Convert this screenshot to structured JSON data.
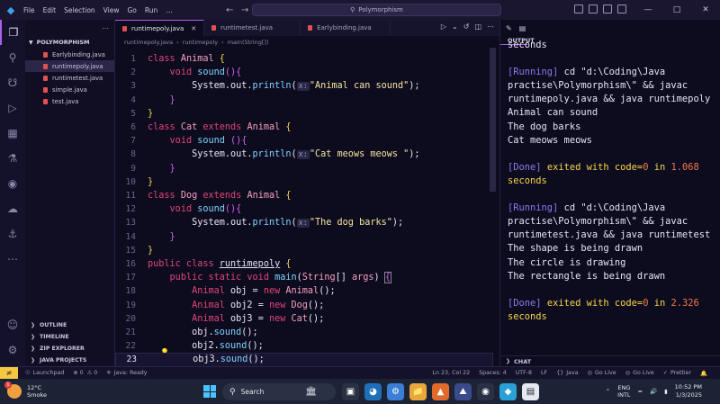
{
  "titlebar": {
    "menu": [
      "File",
      "Edit",
      "Selection",
      "View",
      "Go",
      "Run",
      "…"
    ],
    "search_text": "Polymorphism"
  },
  "sidebar": {
    "folder": "POLYMORPHISM",
    "files": [
      "Earlybinding.java",
      "runtimepoly.java",
      "runtimetest.java",
      "simple.java",
      "test.java"
    ],
    "sections": [
      "OUTLINE",
      "TIMELINE",
      "ZIP EXPLORER",
      "JAVA PROJECTS"
    ]
  },
  "tabs": [
    "runtimepoly.java",
    "runtimetest.java",
    "Earlybinding.java"
  ],
  "breadcrumb": [
    "runtimepoly.java",
    "runtimepoly",
    "main(String[])"
  ],
  "panel": {
    "title": "OUTPUT",
    "chat": "CHAT",
    "lines": [
      {
        "t": "seconds",
        "c": ""
      },
      {
        "t": "",
        "c": ""
      },
      {
        "t": "[Running] cd \"d:\\Coding\\Java",
        "c": "run"
      },
      {
        "t": "practise\\Polymorphism\\\" && javac",
        "c": ""
      },
      {
        "t": "runtimepoly.java && java runtimepoly",
        "c": ""
      },
      {
        "t": "Animal can sound",
        "c": ""
      },
      {
        "t": "The dog barks",
        "c": ""
      },
      {
        "t": "Cat meows meows",
        "c": ""
      },
      {
        "t": "",
        "c": ""
      },
      {
        "t": "[Done] exited with code=0 in 1.068",
        "c": "done"
      },
      {
        "t": "seconds",
        "c": "done"
      },
      {
        "t": "",
        "c": ""
      },
      {
        "t": "[Running] cd \"d:\\Coding\\Java",
        "c": "run"
      },
      {
        "t": "practise\\Polymorphism\\\" && javac",
        "c": ""
      },
      {
        "t": "runtimetest.java && java runtimetest",
        "c": ""
      },
      {
        "t": "The shape is being drawn",
        "c": ""
      },
      {
        "t": "The circle is drawing",
        "c": ""
      },
      {
        "t": "The rectangle is being drawn",
        "c": ""
      },
      {
        "t": "",
        "c": ""
      },
      {
        "t": "[Done] exited with code=0 in 2.326",
        "c": "done"
      },
      {
        "t": "seconds",
        "c": "done"
      }
    ]
  },
  "statusbar": {
    "launchpad": "Launchpad",
    "errors": "0",
    "warnings": "0",
    "java": "Java: Ready",
    "position": "Ln 23, Col 22",
    "spaces": "Spaces: 4",
    "encoding": "UTF-8",
    "eol": "LF",
    "language": "Java",
    "golive1": "Go Live",
    "golive2": "Go Live",
    "prettier": "Prettier"
  },
  "taskbar": {
    "temp": "12°C",
    "weather": "Smoke",
    "badge": "1",
    "search": "Search",
    "lang1": "ENG",
    "lang2": "INTL",
    "time": "10:52 PM",
    "date": "1/3/2025"
  },
  "code": [
    {
      "n": "1",
      "h": "<span class=\"kw\">class</span> <span class=\"cls\">Animal</span> <span class=\"brace1\">{</span>"
    },
    {
      "n": "2",
      "h": "    <span class=\"kw\">void</span> <span class=\"fn\">sound</span><span class=\"brace2\">(){</span>"
    },
    {
      "n": "3",
      "h": "        System.out.<span class=\"fn\">println</span>(<span class=\"hint\">x:</span><span class=\"str\">\"Animal can sound\"</span>);"
    },
    {
      "n": "4",
      "h": "    <span class=\"brace2\">}</span>"
    },
    {
      "n": "5",
      "h": "<span class=\"brace1\">}</span>"
    },
    {
      "n": "6",
      "h": "<span class=\"kw\">class</span> <span class=\"cls\">Cat</span> <span class=\"kw\">extends</span> <span class=\"cls\">Animal</span> <span class=\"brace1\">{</span>"
    },
    {
      "n": "7",
      "h": "    <span class=\"kw\">void</span> <span class=\"fn\">sound</span> <span class=\"brace2\">(){</span>"
    },
    {
      "n": "8",
      "h": "        System.out.<span class=\"fn\">println</span>(<span class=\"hint\">x:</span><span class=\"str\">\"Cat meows meows \"</span>);"
    },
    {
      "n": "9",
      "h": "    <span class=\"brace2\">}</span>"
    },
    {
      "n": "10",
      "h": "<span class=\"brace1\">}</span>"
    },
    {
      "n": "11",
      "h": "<span class=\"kw\">class</span> <span class=\"cls\">Dog</span> <span class=\"kw\">extends</span> <span class=\"cls\">Animal</span> <span class=\"brace1\">{</span>"
    },
    {
      "n": "12",
      "h": "    <span class=\"kw\">void</span> <span class=\"fn\">sound</span><span class=\"brace2\">(){</span>"
    },
    {
      "n": "13",
      "h": "        System.out.<span class=\"fn\">println</span>(<span class=\"hint\">x:</span><span class=\"str\">\"The dog barks\"</span>);"
    },
    {
      "n": "14",
      "h": "    <span class=\"brace2\">}</span>"
    },
    {
      "n": "15",
      "h": "<span class=\"brace1\">}</span>"
    },
    {
      "n": "16",
      "h": "<span class=\"kw\">public class</span> <span class=\"cls\" style=\"color:#e8e4f5;text-decoration:underline\">runtimepoly</span> <span class=\"brace1\">{</span>"
    },
    {
      "n": "17",
      "h": "    <span class=\"kw\">public static void</span> <span class=\"fn\">main</span>(<span class=\"cls\">String</span>[] <span class=\"cls\">args</span>) <span class=\"brace2\" style=\"outline:1px solid #888\">{</span>"
    },
    {
      "n": "18",
      "h": "        <span class=\"kw\">Animal</span> obj = <span class=\"kw\">new</span> <span class=\"cls\">Animal</span>();"
    },
    {
      "n": "19",
      "h": "        <span class=\"kw\">Animal</span> obj2 = <span class=\"kw\">new</span> <span class=\"cls\">Dog</span>();"
    },
    {
      "n": "20",
      "h": "        <span class=\"kw\">Animal</span> obj3 = <span class=\"kw\">new</span> <span class=\"cls\">Cat</span>();"
    },
    {
      "n": "21",
      "h": "        obj.<span class=\"fn\">sound</span>();"
    },
    {
      "n": "22",
      "h": "        obj2.<span class=\"fn\">sound</span>();"
    },
    {
      "n": "23",
      "h": "        obj3.<span class=\"fn\">sound</span>();"
    }
  ]
}
